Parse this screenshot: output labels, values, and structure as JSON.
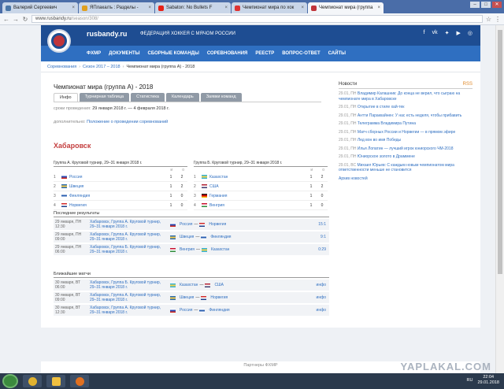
{
  "browser": {
    "tabs": [
      {
        "label": "Валерий Сергеевич",
        "fav": "#4a76a8"
      },
      {
        "label": "ЯПлакалъ : Разделы -",
        "fav": "#e0a020"
      },
      {
        "label": "Sabaton: No Bullets F",
        "fav": "#e62117"
      },
      {
        "label": "Чемпионат мира по хок",
        "fav": "#d33"
      },
      {
        "label": "Чемпионат мира (группа",
        "fav": "#c0343a"
      }
    ],
    "url_host": "www.rusbandy.ru",
    "url_path": "/season/308/"
  },
  "site": {
    "brand": "rusbandy.ru",
    "federation": "ФЕДЕРАЦИЯ ХОККЕЯ С МЯЧОМ РОССИИ",
    "social": [
      "f",
      "vk",
      "tw",
      "yt",
      "in"
    ],
    "nav": [
      "ФХМР",
      "ДОКУМЕНТЫ",
      "СБОРНЫЕ КОМАНДЫ",
      "СОРЕВНОВАНИЯ",
      "РЕЕСТР",
      "ВОПРОС-ОТВЕТ",
      "САЙТЫ"
    ]
  },
  "breadcrumbs": [
    "Соревнования",
    "Сезон 2017 – 2018",
    "Чемпионат мира (группа А) - 2018"
  ],
  "page": {
    "title": "Чемпионат мира (группа А) - 2018",
    "tabs": [
      "Инфо",
      "Турнирная таблица",
      "Статистика",
      "Календарь",
      "Заявки команд"
    ],
    "dates_label": "сроки проведения:",
    "dates_value": "29 января 2018 г. — 4 февраля 2018 г.",
    "extra_label": "дополнительно:",
    "extra_value": "Положение о проведении соревнований",
    "city": "Хабаровск"
  },
  "groups": [
    {
      "caption": "Группа А. Круговой турнир, 29–31 января 2018 г.",
      "col1": "и",
      "col2": "о",
      "rows": [
        {
          "n": "1",
          "team": "Россия",
          "flag": "ru",
          "g": "1",
          "p": "2"
        },
        {
          "n": "2",
          "team": "Швеция",
          "flag": "se",
          "g": "1",
          "p": "2"
        },
        {
          "n": "3",
          "team": "Финляндия",
          "flag": "fi",
          "g": "1",
          "p": "0"
        },
        {
          "n": "4",
          "team": "Норвегия",
          "flag": "no",
          "g": "1",
          "p": "0"
        }
      ]
    },
    {
      "caption": "Группа Б. Круговой турнир, 29–31 января 2018 г.",
      "col1": "и",
      "col2": "о",
      "rows": [
        {
          "n": "1",
          "team": "Казахстан",
          "flag": "kz",
          "g": "1",
          "p": "2"
        },
        {
          "n": "2",
          "team": "США",
          "flag": "us",
          "g": "1",
          "p": "2"
        },
        {
          "n": "3",
          "team": "Германия",
          "flag": "de",
          "g": "1",
          "p": "0"
        },
        {
          "n": "4",
          "team": "Венгрия",
          "flag": "hu",
          "g": "1",
          "p": "0"
        }
      ]
    }
  ],
  "results": {
    "title": "Последние результаты",
    "rows": [
      {
        "date": "29 января, ПН",
        "time": "12:30",
        "l1": "Хабаровск, Группа А. Круговой турнир,",
        "l2": "29–31 января 2018 г.",
        "a": "Россия",
        "fa": "ru",
        "b": "Норвегия",
        "fb": "no",
        "score": "15:1"
      },
      {
        "date": "29 января, ПН",
        "time": "09:00",
        "l1": "Хабаровск, Группа А. Круговой турнир,",
        "l2": "29–31 января 2018 г.",
        "a": "Швеция",
        "fa": "se",
        "b": "Финляндия",
        "fb": "fi",
        "score": "9:1"
      },
      {
        "date": "29 января, ПН",
        "time": "06:00",
        "l1": "Хабаровск, Группа Б. Круговой турнир,",
        "l2": "29–31 января 2018 г.",
        "a": "Венгрия",
        "fa": "hu",
        "b": "Казахстан",
        "fb": "kz",
        "score": "0:29"
      }
    ]
  },
  "upcoming": {
    "title": "Ближайшие матчи",
    "rows": [
      {
        "date": "30 января, ВТ",
        "time": "06:00",
        "l1": "Хабаровск, Группа Б. Круговой турнир,",
        "l2": "29–31 января 2018 г.",
        "a": "Казахстан",
        "fa": "kz",
        "b": "США",
        "fb": "us",
        "score": "инфо"
      },
      {
        "date": "30 января, ВТ",
        "time": "09:00",
        "l1": "Хабаровск, Группа А. Круговой турнир,",
        "l2": "29–31 января 2018 г.",
        "a": "Швеция",
        "fa": "se",
        "b": "Норвегия",
        "fb": "no",
        "score": "инфо"
      },
      {
        "date": "30 января, ВТ",
        "time": "12:30",
        "l1": "Хабаровск, Группа А. Круговой турнир,",
        "l2": "29–31 января 2018 г.",
        "a": "Россия",
        "fa": "ru",
        "b": "Финляндия",
        "fb": "fi",
        "score": "инфо"
      }
    ]
  },
  "news": {
    "title": "Новости",
    "rss": "RSS",
    "items": [
      {
        "date": "29.01, ПН",
        "text": "Владимир Калашник: До конца не верил, что сыграю на чемпионате мира в Хабаровске"
      },
      {
        "date": "29.01, ПН",
        "text": "Открытие в стиле хай-тек"
      },
      {
        "date": "29.01, ПН",
        "text": "Антти Параккайнен: У нас есть неделя, чтобы прибавить"
      },
      {
        "date": "29.01, ПН",
        "text": "Телеграмма Владимира Путина"
      },
      {
        "date": "29.01, ПН",
        "text": "Матч сборных России и Норвегии — в прямом эфире"
      },
      {
        "date": "29.01, ПН",
        "text": "Лед вон во имя Победы"
      },
      {
        "date": "29.01, ПН",
        "text": "Илья Лопатин — лучший игрок юниорского ЧМ-2018"
      },
      {
        "date": "29.01, ПН",
        "text": "Юниорское золото в Драмменe"
      },
      {
        "date": "29.01, ВС",
        "text": "Михаил Юрьев: С каждым новым чемпионатом мира ответственности меньше не становится"
      }
    ],
    "archive": "Архив новостей"
  },
  "footer": "Партнеры ФХМР",
  "watermark": "YAPLAKAL.COM",
  "taskbar": {
    "time": "22:04",
    "date": "29.01.2018",
    "lang": "RU"
  },
  "flags": {
    "ru": [
      "#fff",
      "#2a4db5",
      "#d52b1e"
    ],
    "se": [
      "#2b6cb0",
      "#f2c94c",
      "#2b6cb0"
    ],
    "fi": [
      "#fff",
      "#2b5fb0",
      "#fff"
    ],
    "no": [
      "#d02a2a",
      "#fff",
      "#1d3f8a"
    ],
    "kz": [
      "#35b3d6",
      "#f2d14b",
      "#35b3d6"
    ],
    "us": [
      "#b22234",
      "#fff",
      "#3c3b6e"
    ],
    "de": [
      "#222",
      "#d00",
      "#f2c200"
    ],
    "hu": [
      "#c8102e",
      "#fff",
      "#2e8b3a"
    ]
  }
}
